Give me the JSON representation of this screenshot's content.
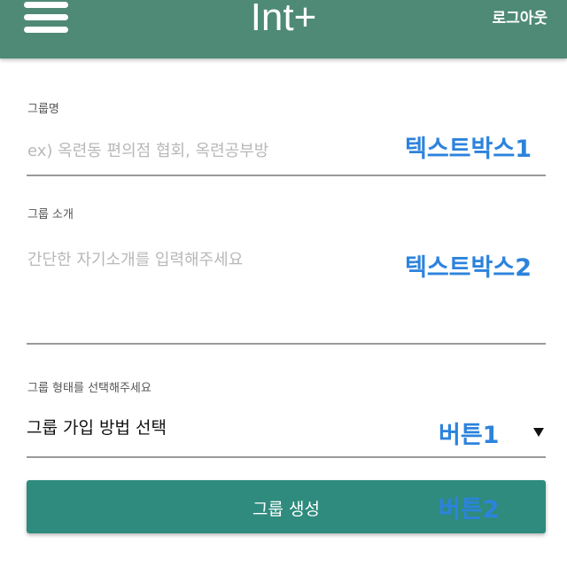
{
  "header": {
    "title": "Int+",
    "logout_label": "로그아웃",
    "menu_icon": "hamburger-menu-icon",
    "background_color": "#4e8a76"
  },
  "form": {
    "group_name": {
      "label": "그룹명",
      "placeholder": "ex) 옥련동 편의점 협회, 옥련공부방",
      "value": ""
    },
    "group_intro": {
      "label": "그룹 소개",
      "placeholder": "간단한 자기소개를 입력해주세요",
      "value": ""
    },
    "group_type": {
      "label": "그룹 형태를 선택해주세요",
      "selected": "그룹 가입 방법 선택",
      "caret_icon": "caret-down-icon"
    },
    "submit_label": "그룹 생성",
    "submit_color": "#2e8b7d"
  },
  "annotations": {
    "textbox1": "텍스트박스1",
    "textbox2": "텍스트박스2",
    "button1": "버튼1",
    "button2": "버튼2",
    "color": "#2c83dc"
  }
}
